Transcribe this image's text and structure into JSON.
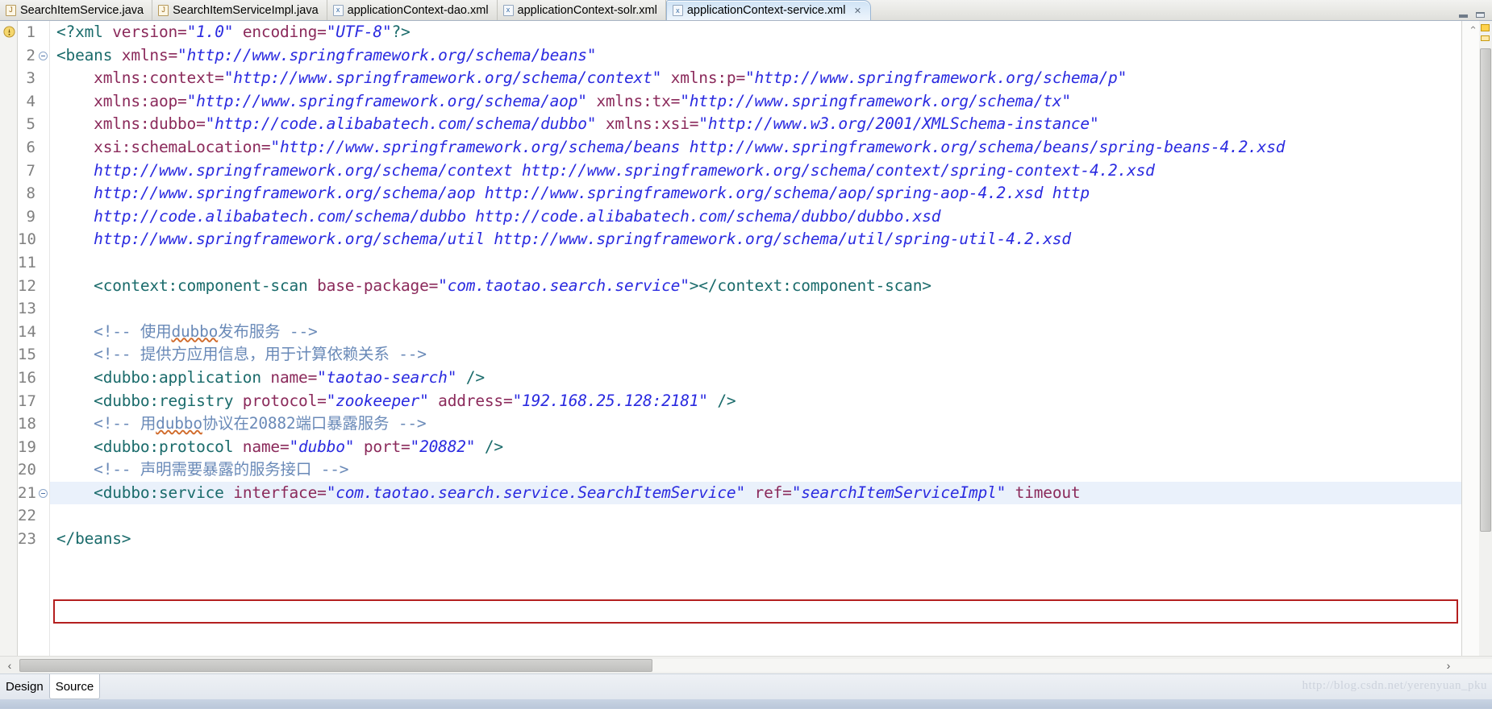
{
  "tabs": [
    {
      "label": "SearchItemService.java",
      "icon": "java-file-icon",
      "icon_glyph": "J",
      "kind": "java",
      "active": false,
      "closable": false
    },
    {
      "label": "SearchItemServiceImpl.java",
      "icon": "java-file-icon",
      "icon_glyph": "J",
      "kind": "java",
      "active": false,
      "closable": false
    },
    {
      "label": "applicationContext-dao.xml",
      "icon": "xml-file-icon",
      "icon_glyph": "x",
      "kind": "xml",
      "active": false,
      "closable": false
    },
    {
      "label": "applicationContext-solr.xml",
      "icon": "xml-file-icon",
      "icon_glyph": "x",
      "kind": "xml",
      "active": false,
      "closable": false
    },
    {
      "label": "applicationContext-service.xml",
      "icon": "xml-file-icon",
      "icon_glyph": "x",
      "kind": "xml",
      "active": true,
      "closable": true,
      "close_glyph": "✕"
    }
  ],
  "window_controls": {
    "minimize": "minimize-button",
    "restore": "restore-button"
  },
  "editor": {
    "current_line": 21,
    "warning_line": 1,
    "lines": [
      {
        "n": "1",
        "segments": [
          {
            "t": "<?",
            "c": "tg"
          },
          {
            "t": "xml",
            "c": "tg"
          },
          {
            "t": " version=",
            "c": "at"
          },
          {
            "t": "\"1.0\"",
            "c": "vl"
          },
          {
            "t": " encoding=",
            "c": "at"
          },
          {
            "t": "\"UTF-8\"",
            "c": "vl"
          },
          {
            "t": "?>",
            "c": "tg"
          }
        ]
      },
      {
        "n": "2",
        "fold": true,
        "indent": 0,
        "segments": [
          {
            "t": "<beans",
            "c": "tg"
          },
          {
            "t": " xmlns=",
            "c": "at"
          },
          {
            "t": "\"http://www.springframework.org/schema/beans\"",
            "c": "vl"
          }
        ]
      },
      {
        "n": "3",
        "segments": [
          {
            "t": "    xmlns:context=",
            "c": "at"
          },
          {
            "t": "\"http://www.springframework.org/schema/context\"",
            "c": "vl"
          },
          {
            "t": " xmlns:p=",
            "c": "at"
          },
          {
            "t": "\"http://www.springframework.org/schema/p\"",
            "c": "vl"
          }
        ]
      },
      {
        "n": "4",
        "segments": [
          {
            "t": "    xmlns:aop=",
            "c": "at"
          },
          {
            "t": "\"http://www.springframework.org/schema/aop\"",
            "c": "vl"
          },
          {
            "t": " xmlns:tx=",
            "c": "at"
          },
          {
            "t": "\"http://www.springframework.org/schema/tx\"",
            "c": "vl"
          }
        ]
      },
      {
        "n": "5",
        "segments": [
          {
            "t": "    xmlns:dubbo=",
            "c": "at"
          },
          {
            "t": "\"http://code.alibabatech.com/schema/dubbo\"",
            "c": "vl"
          },
          {
            "t": " xmlns:xsi=",
            "c": "at"
          },
          {
            "t": "\"http://www.w3.org/2001/XMLSchema-instance\"",
            "c": "vl"
          }
        ]
      },
      {
        "n": "6",
        "segments": [
          {
            "t": "    xsi:schemaLocation=",
            "c": "at"
          },
          {
            "t": "\"http://www.springframework.org/schema/beans http://www.springframework.org/schema/beans/spring-beans-4.2.xsd",
            "c": "vl"
          }
        ]
      },
      {
        "n": "7",
        "segments": [
          {
            "t": "    http://www.springframework.org/schema/context http://www.springframework.org/schema/context/spring-context-4.2.xsd",
            "c": "vl"
          }
        ]
      },
      {
        "n": "8",
        "segments": [
          {
            "t": "    http://www.springframework.org/schema/aop http://www.springframework.org/schema/aop/spring-aop-4.2.xsd http",
            "c": "vl"
          }
        ]
      },
      {
        "n": "9",
        "segments": [
          {
            "t": "    http://code.alibabatech.com/schema/dubbo http://code.alibabatech.com/schema/dubbo/dubbo.xsd",
            "c": "vl"
          }
        ]
      },
      {
        "n": "10",
        "segments": [
          {
            "t": "    http://www.springframework.org/schema/util http://www.springframework.org/schema/util/spring-util-4.2.xsd",
            "c": "vl"
          }
        ]
      },
      {
        "n": "11",
        "segments": []
      },
      {
        "n": "12",
        "segments": [
          {
            "t": "    <context:component-scan",
            "c": "tg"
          },
          {
            "t": " base-package=",
            "c": "at"
          },
          {
            "t": "\"com.taotao.search.service\"",
            "c": "vl"
          },
          {
            "t": "></context:component-scan>",
            "c": "tg"
          }
        ]
      },
      {
        "n": "13",
        "segments": []
      },
      {
        "n": "14",
        "segments": [
          {
            "t": "    <!-- 使用",
            "c": "cm"
          },
          {
            "t": "dubbo",
            "c": "cm squig"
          },
          {
            "t": "发布服务 -->",
            "c": "cm"
          }
        ]
      },
      {
        "n": "15",
        "segments": [
          {
            "t": "    <!-- 提供方应用信息，用于计算依赖关系 -->",
            "c": "cm"
          }
        ]
      },
      {
        "n": "16",
        "segments": [
          {
            "t": "    <dubbo:application",
            "c": "tg"
          },
          {
            "t": " name=",
            "c": "at"
          },
          {
            "t": "\"taotao-search\"",
            "c": "vl"
          },
          {
            "t": " />",
            "c": "tg"
          }
        ]
      },
      {
        "n": "17",
        "segments": [
          {
            "t": "    <dubbo:registry",
            "c": "tg"
          },
          {
            "t": " protocol=",
            "c": "at"
          },
          {
            "t": "\"zookeeper\"",
            "c": "vl"
          },
          {
            "t": " address=",
            "c": "at"
          },
          {
            "t": "\"192.168.25.128:2181\"",
            "c": "vl"
          },
          {
            "t": " />",
            "c": "tg"
          }
        ]
      },
      {
        "n": "18",
        "segments": [
          {
            "t": "    <!-- 用",
            "c": "cm"
          },
          {
            "t": "dubbo",
            "c": "cm squig"
          },
          {
            "t": "协议在20882端口暴露服务 -->",
            "c": "cm"
          }
        ]
      },
      {
        "n": "19",
        "segments": [
          {
            "t": "    <dubbo:protocol",
            "c": "tg"
          },
          {
            "t": " name=",
            "c": "at"
          },
          {
            "t": "\"dubbo\"",
            "c": "vl"
          },
          {
            "t": " port=",
            "c": "at"
          },
          {
            "t": "\"20882\"",
            "c": "vl"
          },
          {
            "t": " />",
            "c": "tg"
          }
        ]
      },
      {
        "n": "20",
        "segments": [
          {
            "t": "    <!-- 声明需要暴露的服务接口 -->",
            "c": "cm"
          }
        ]
      },
      {
        "n": "21",
        "fold": true,
        "current": true,
        "boxed": true,
        "segments": [
          {
            "t": "    <dubbo:service",
            "c": "tg"
          },
          {
            "t": " interface=",
            "c": "at"
          },
          {
            "t": "\"com.taotao.search.service.SearchItemService\"",
            "c": "vl"
          },
          {
            "t": " ref=",
            "c": "at"
          },
          {
            "t": "\"searchItemServiceImpl\"",
            "c": "vl"
          },
          {
            "t": " timeout",
            "c": "at"
          }
        ]
      },
      {
        "n": "22",
        "segments": []
      },
      {
        "n": "23",
        "segments": [
          {
            "t": "</beans>",
            "c": "tg"
          }
        ]
      }
    ]
  },
  "scrollbars": {
    "vertical_up_glyph": "⌃",
    "horizontal_left_glyph": "‹",
    "horizontal_right_glyph": "›"
  },
  "bottom_tabs": [
    {
      "label": "Design",
      "active": false
    },
    {
      "label": "Source",
      "active": true
    }
  ],
  "watermark": "http://blog.csdn.net/yerenyuan_pku",
  "colors": {
    "tag": "#1a6b6b",
    "attribute": "#8b2a5b",
    "value": "#2a2ae0",
    "comment": "#6a8ab8",
    "current_line_bg": "#eaf1fb",
    "error_box": "#b41f1f",
    "warning_marker": "#ffd24d"
  }
}
